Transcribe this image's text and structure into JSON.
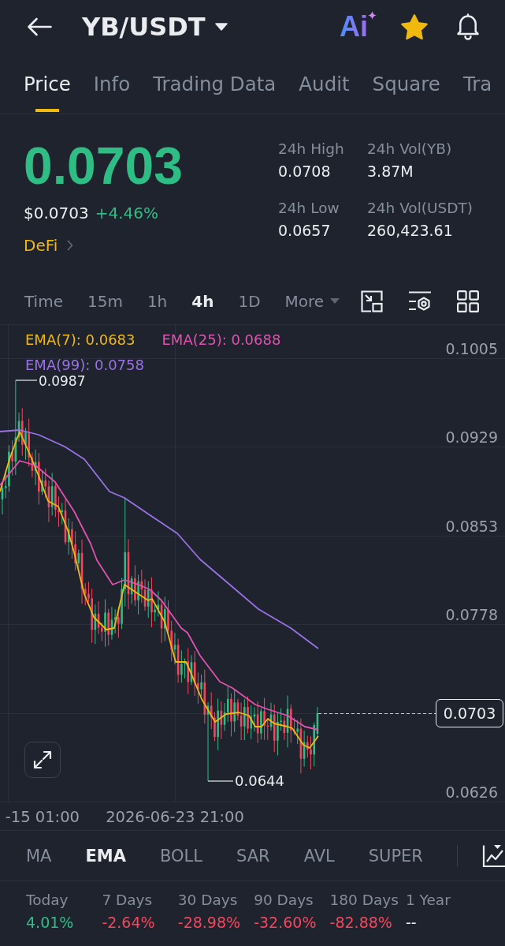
{
  "header": {
    "title": "YB/USDT",
    "ai_label": "Ai",
    "favorite": true
  },
  "tabs": [
    {
      "label": "Price",
      "selected": true
    },
    {
      "label": "Info",
      "selected": false
    },
    {
      "label": "Trading Data",
      "selected": false
    },
    {
      "label": "Audit",
      "selected": false
    },
    {
      "label": "Square",
      "selected": false
    },
    {
      "label": "Tra",
      "selected": false
    }
  ],
  "price": {
    "last": "0.0703",
    "rising": true,
    "fiat": "$0.0703",
    "change": "+4.46%",
    "category": "DeFi"
  },
  "stats": [
    {
      "label": "24h High",
      "value": "0.0708"
    },
    {
      "label": "24h Vol(YB)",
      "value": "3.87M"
    },
    {
      "label": "24h Low",
      "value": "0.0657"
    },
    {
      "label": "24h Vol(USDT)",
      "value": "260,423.61"
    }
  ],
  "intervals": [
    {
      "label": "Time",
      "kind": "option",
      "selected": false
    },
    {
      "label": "15m",
      "kind": "option",
      "selected": false
    },
    {
      "label": "1h",
      "kind": "option",
      "selected": false
    },
    {
      "label": "4h",
      "kind": "option",
      "selected": true
    },
    {
      "label": "1D",
      "kind": "option",
      "selected": false
    },
    {
      "label": "More",
      "kind": "menu",
      "selected": false
    }
  ],
  "chart": {
    "legend": [
      {
        "label": "EMA(7): 0.0683",
        "color": "#f0b90b"
      },
      {
        "label": "EMA(25): 0.0688",
        "color": "#e052b0"
      },
      {
        "label": "EMA(99): 0.0758",
        "color": "#9b72e6"
      }
    ],
    "y_labels": [
      "0.1005",
      "0.0929",
      "0.0853",
      "0.0778",
      "0.0626"
    ],
    "x_labels": [
      "-15 01:00",
      "2026-06-23 21:00"
    ],
    "high_marker": "0.0987",
    "low_marker": "0.0644",
    "last_price_tag": "0.0703"
  },
  "indicators": [
    {
      "label": "MA",
      "selected": false
    },
    {
      "label": "EMA",
      "selected": true
    },
    {
      "label": "BOLL",
      "selected": false
    },
    {
      "label": "SAR",
      "selected": false
    },
    {
      "label": "AVL",
      "selected": false
    },
    {
      "label": "SUPER",
      "selected": false
    }
  ],
  "periods": [
    {
      "label": "Today",
      "value": "4.01%",
      "color": "#2ebd85"
    },
    {
      "label": "7 Days",
      "value": "-2.64%",
      "color": "#f6465d"
    },
    {
      "label": "30 Days",
      "value": "-28.98%",
      "color": "#f6465d"
    },
    {
      "label": "90 Days",
      "value": "-32.60%",
      "color": "#f6465d"
    },
    {
      "label": "180 Days",
      "value": "-82.88%",
      "color": "#f6465d"
    },
    {
      "label": "1 Year",
      "value": "--",
      "color": "#eaecef"
    }
  ]
}
